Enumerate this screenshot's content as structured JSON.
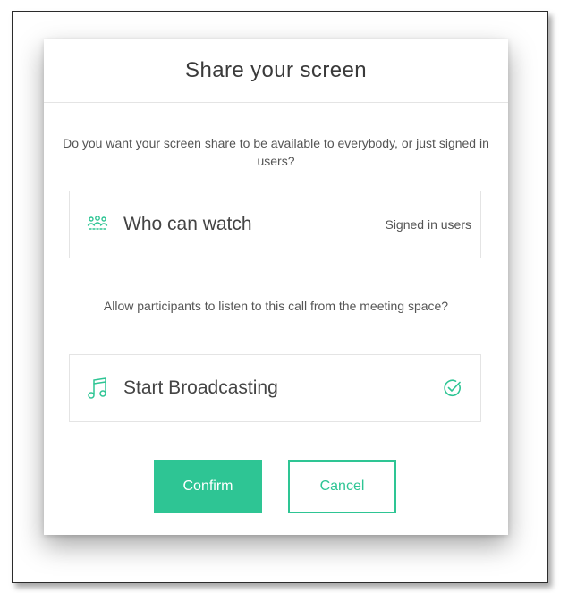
{
  "dialog": {
    "title": "Share your screen",
    "prompt_visibility": "Do you want your screen share to be available to everybody, or just signed in users?",
    "prompt_broadcast": "Allow participants to listen to this call from the meeting space?",
    "who_can_watch": {
      "label": "Who can watch",
      "value": "Signed in users",
      "icon": "people-group-icon"
    },
    "broadcast": {
      "label": "Start Broadcasting",
      "icon": "music-note-icon",
      "checked": true,
      "status_icon": "check-circle-icon"
    },
    "buttons": {
      "confirm_label": "Confirm",
      "cancel_label": "Cancel"
    }
  },
  "colors": {
    "accent": "#2ec594",
    "text": "#444444",
    "muted_text": "#555555",
    "border": "#e4e4e4"
  }
}
